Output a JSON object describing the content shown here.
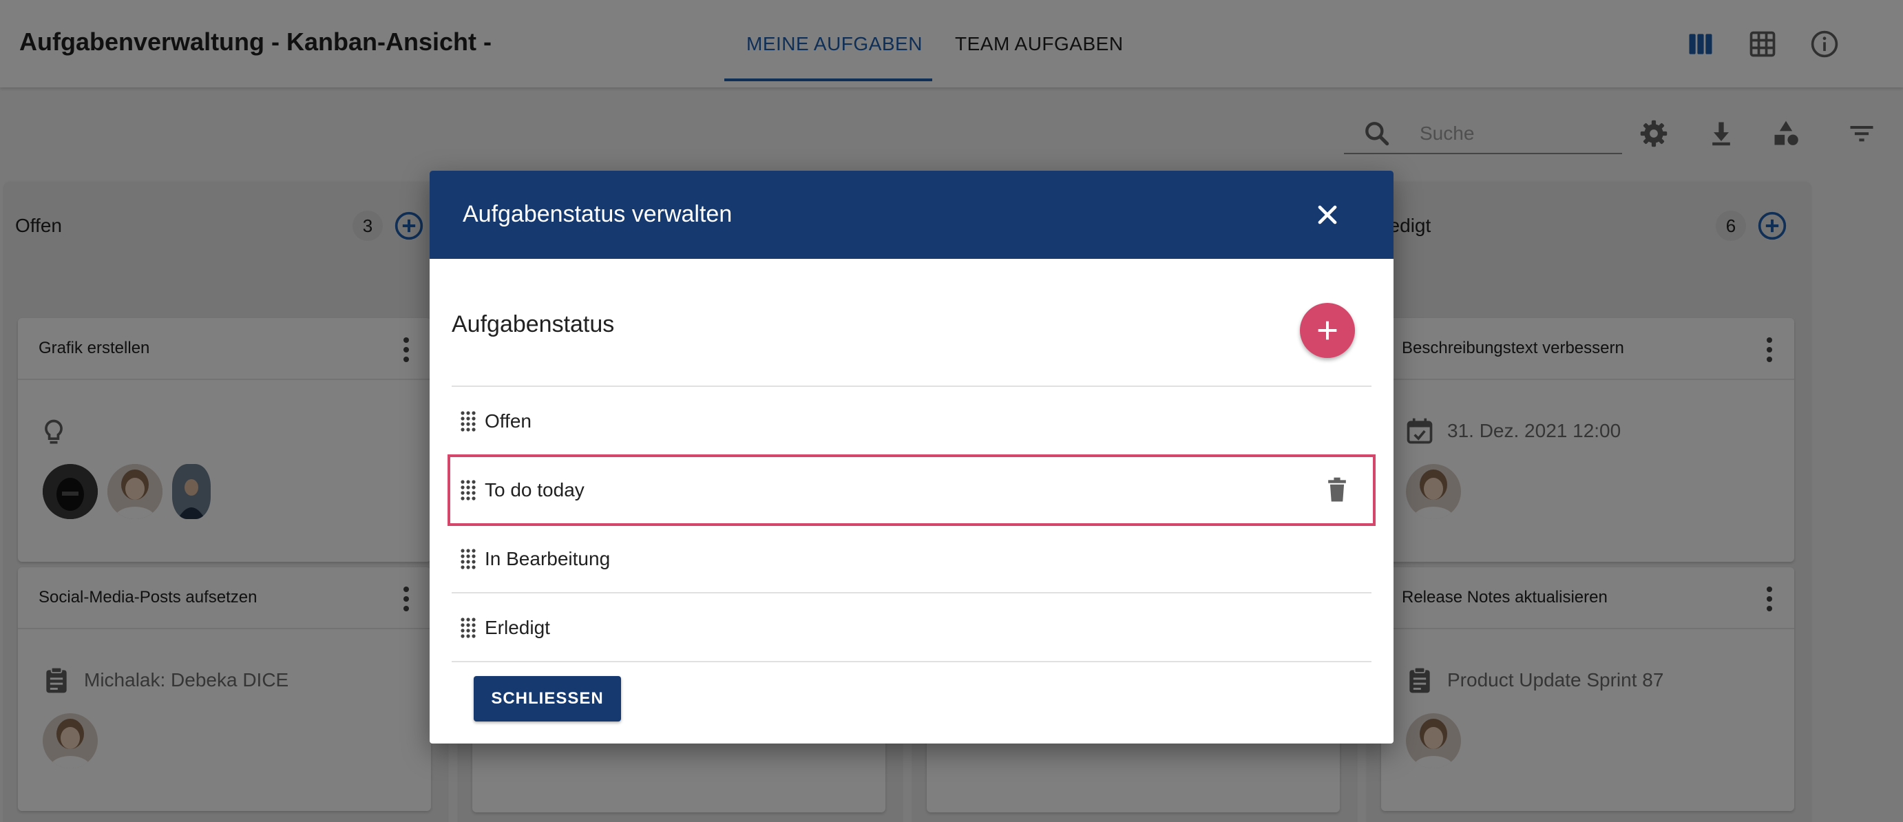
{
  "app": {
    "title": "Aufgabenverwaltung - Kanban-Ansicht -",
    "tabs": [
      {
        "label": "MEINE AUFGABEN",
        "active": true
      },
      {
        "label": "TEAM AUFGABEN",
        "active": false
      }
    ],
    "view_icons": [
      "kanban-view-icon",
      "table-view-icon",
      "info-icon"
    ]
  },
  "toolbar": {
    "search_placeholder": "Suche",
    "search_value": "",
    "icons": [
      "settings-icon",
      "download-icon",
      "shapes-icon",
      "filter-icon"
    ]
  },
  "columns": [
    {
      "title": "Offen",
      "count": "3",
      "cards": [
        {
          "title": "Grafik erstellen",
          "icon": "lightbulb-icon",
          "detail": "",
          "avatars": 3
        },
        {
          "title": "Social-Media-Posts aufsetzen",
          "icon": "clipboard-icon",
          "detail": "Michalak: Debeka DICE",
          "avatars": 1
        }
      ]
    },
    {
      "title": "Erledigt",
      "visible_title": "rledigt",
      "count": "6",
      "cards": [
        {
          "title": "Beschreibungstext verbessern",
          "icon": "calendar-check-icon",
          "detail": "31. Dez. 2021 12:00",
          "avatars": 1
        },
        {
          "title": "Release Notes aktualisieren",
          "icon": "clipboard-icon",
          "detail": "Product Update Sprint 87",
          "avatars": 1
        }
      ]
    }
  ],
  "dialog": {
    "title": "Aufgabenstatus verwalten",
    "section_title": "Aufgabenstatus",
    "statuses": [
      {
        "label": "Offen",
        "selected": false
      },
      {
        "label": "To do today",
        "selected": true
      },
      {
        "label": "In Bearbeitung",
        "selected": false
      },
      {
        "label": "Erledigt",
        "selected": false
      }
    ],
    "close_button": "SCHLIESSEN"
  },
  "colors": {
    "primary": "#163a70",
    "accent": "#d5476a",
    "tab_active": "#1f5fae",
    "overlay": "rgba(0,0,0,0.5)"
  }
}
